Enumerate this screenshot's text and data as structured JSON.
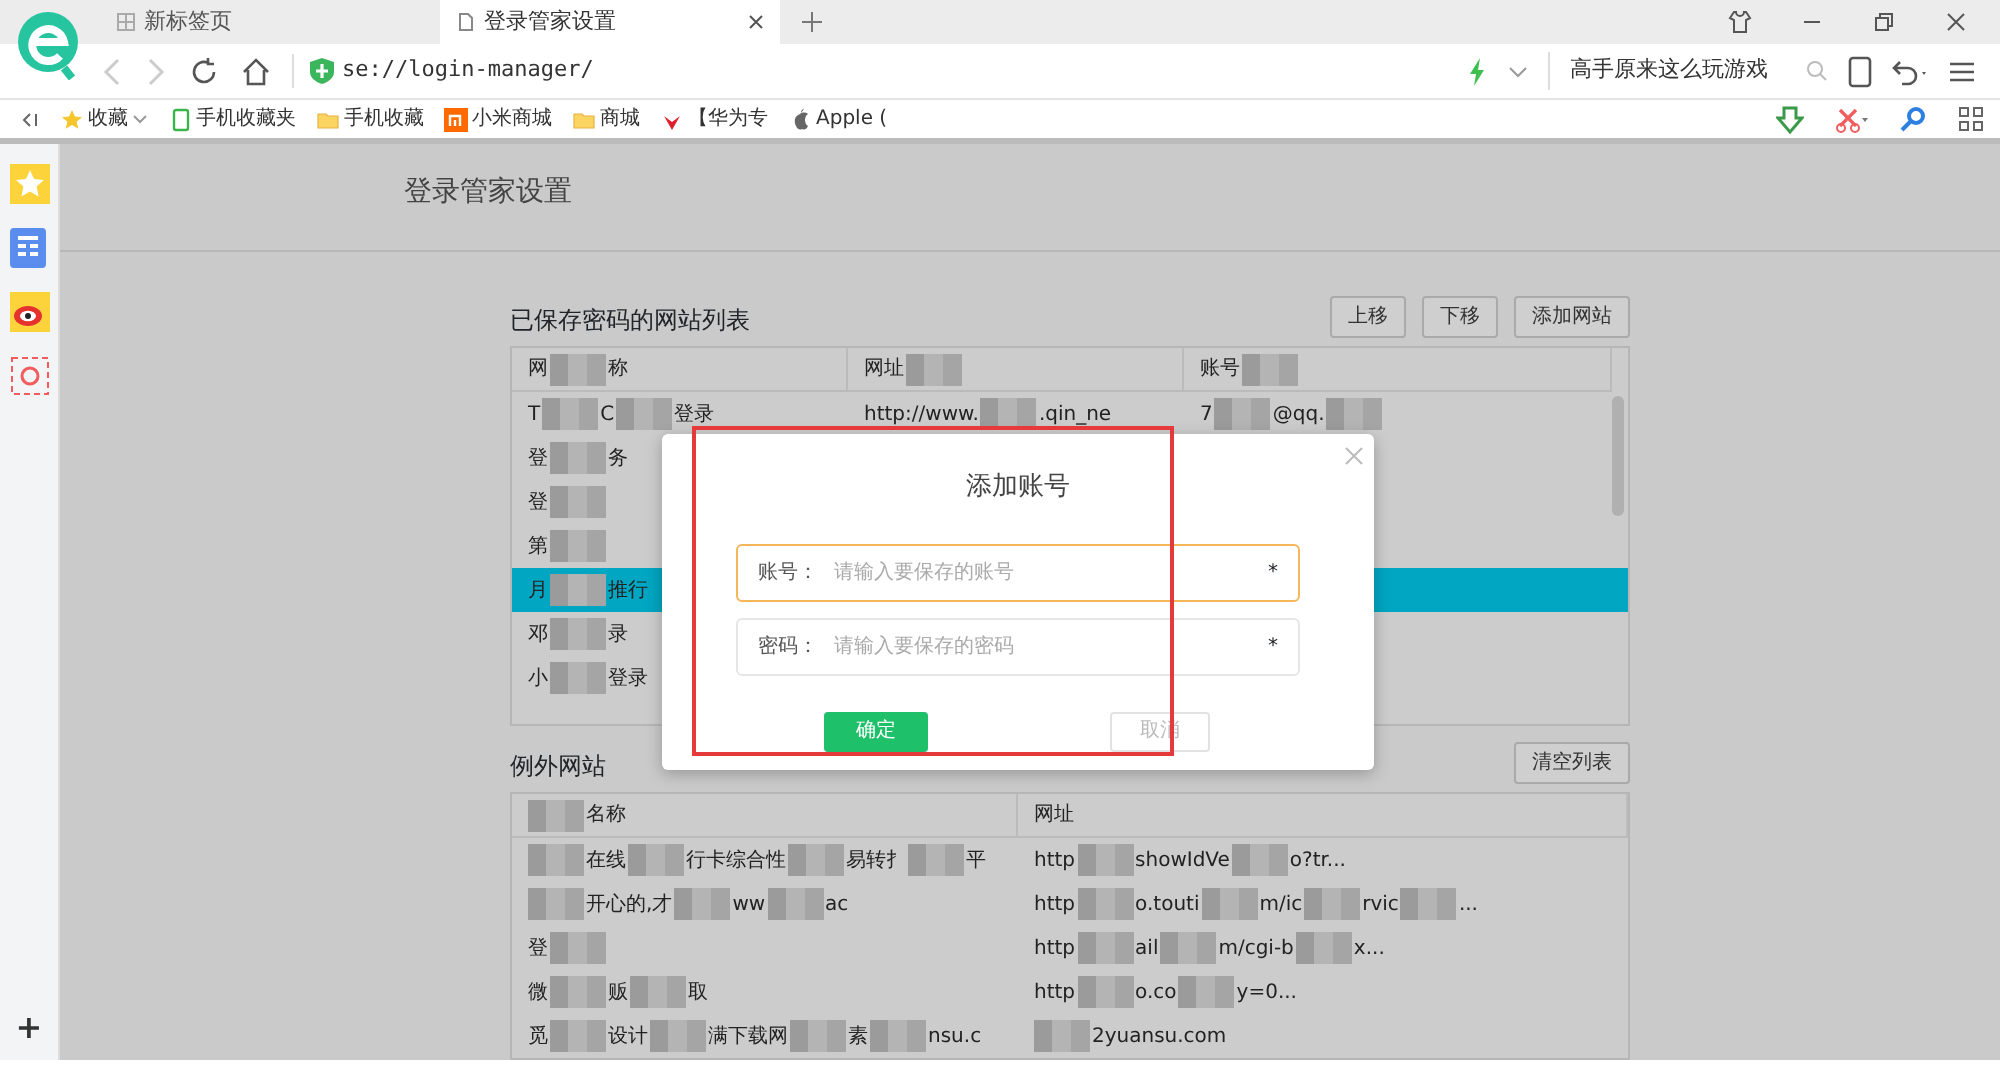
{
  "tabs": [
    {
      "label": "新标签页",
      "selected": false
    },
    {
      "label": "登录管家设置",
      "selected": true
    }
  ],
  "address": "se://login-manager/",
  "search": {
    "placeholder": "高手原来这么玩游戏"
  },
  "bookmarks": [
    {
      "label": "收藏",
      "kind": "star"
    },
    {
      "label": "手机收藏夹",
      "kind": "phone"
    },
    {
      "label": "手机收藏",
      "kind": "folder"
    },
    {
      "label": "小米商城",
      "kind": "mi"
    },
    {
      "label": "商城",
      "kind": "folder"
    },
    {
      "label": "【华为专",
      "kind": "huawei"
    },
    {
      "label": "Apple (",
      "kind": "apple"
    }
  ],
  "page_title": "登录管家设置",
  "saved": {
    "title": "已保存密码的网站列表",
    "buttons": [
      "上移",
      "下移",
      "添加网站"
    ],
    "columns": [
      {
        "parts": [
          "网",
          "称"
        ]
      },
      {
        "parts": [
          "网址"
        ],
        "tail": true
      },
      {
        "parts": [
          "账号"
        ],
        "tail": true
      }
    ],
    "rows": [
      {
        "selected": false,
        "cells": [
          {
            "parts": [
              "T",
              "C",
              "登录"
            ]
          },
          {
            "parts": [
              "http://www.",
              ".qin_ne"
            ]
          },
          {
            "parts": [
              "7",
              "@qq."
            ],
            "tail": true
          }
        ]
      },
      {
        "selected": false,
        "cells": [
          {
            "parts": [
              "登",
              "务"
            ]
          }
        ]
      },
      {
        "selected": false,
        "cells": [
          {
            "parts": [
              "登"
            ],
            "tail": true
          }
        ]
      },
      {
        "selected": false,
        "cells": [
          {
            "parts": [
              "第"
            ],
            "tail": true
          }
        ]
      },
      {
        "selected": true,
        "cells": [
          {
            "parts": [
              "月",
              "推行"
            ]
          }
        ]
      },
      {
        "selected": false,
        "cells": [
          {
            "parts": [
              "邓",
              "录"
            ]
          }
        ]
      },
      {
        "selected": false,
        "cells": [
          {
            "parts": [
              "小",
              "登录"
            ]
          }
        ]
      }
    ]
  },
  "exceptions": {
    "title": "例外网站",
    "button": "清空列表",
    "columns": [
      {
        "parts": [
          "名称"
        ],
        "lead": true
      },
      {
        "parts": [
          "网址"
        ]
      }
    ],
    "rows": [
      {
        "cells": [
          {
            "parts": [
              "在线",
              "行卡综合性",
              "易转扌",
              "平"
            ],
            "lead": true
          },
          {
            "parts": [
              "http",
              "showIdVe",
              "o?tr..."
            ]
          }
        ]
      },
      {
        "cells": [
          {
            "parts": [
              "开心的,才",
              "ww",
              "ac"
            ],
            "lead": true
          },
          {
            "parts": [
              "http",
              "o.touti",
              "m/ic",
              "rvic",
              "..."
            ]
          }
        ]
      },
      {
        "cells": [
          {
            "parts": [
              "登"
            ],
            "tail": true
          },
          {
            "parts": [
              "http",
              "ail",
              "m/cgi-b",
              "x..."
            ]
          }
        ]
      },
      {
        "cells": [
          {
            "parts": [
              "微",
              "贩",
              "取"
            ]
          },
          {
            "parts": [
              "http",
              "o.co",
              "y=0..."
            ]
          }
        ]
      },
      {
        "cells": [
          {
            "parts": [
              "觅",
              "设计",
              "满下载网",
              "素",
              "nsu.c"
            ]
          },
          {
            "parts": [
              "2yuansu.com"
            ],
            "lead": true
          }
        ]
      }
    ]
  },
  "dialog": {
    "title": "添加账号",
    "fields": [
      {
        "label": "账号：",
        "placeholder": "请输入要保存的账号",
        "required_mark": "*",
        "focused": true
      },
      {
        "label": "密码：",
        "placeholder": "请输入要保存的密码",
        "required_mark": "*",
        "focused": false
      }
    ],
    "buttons": [
      {
        "label": "确定",
        "kind": "primary"
      },
      {
        "label": "取消",
        "kind": "secondary"
      }
    ]
  },
  "sidebar_add": "+"
}
